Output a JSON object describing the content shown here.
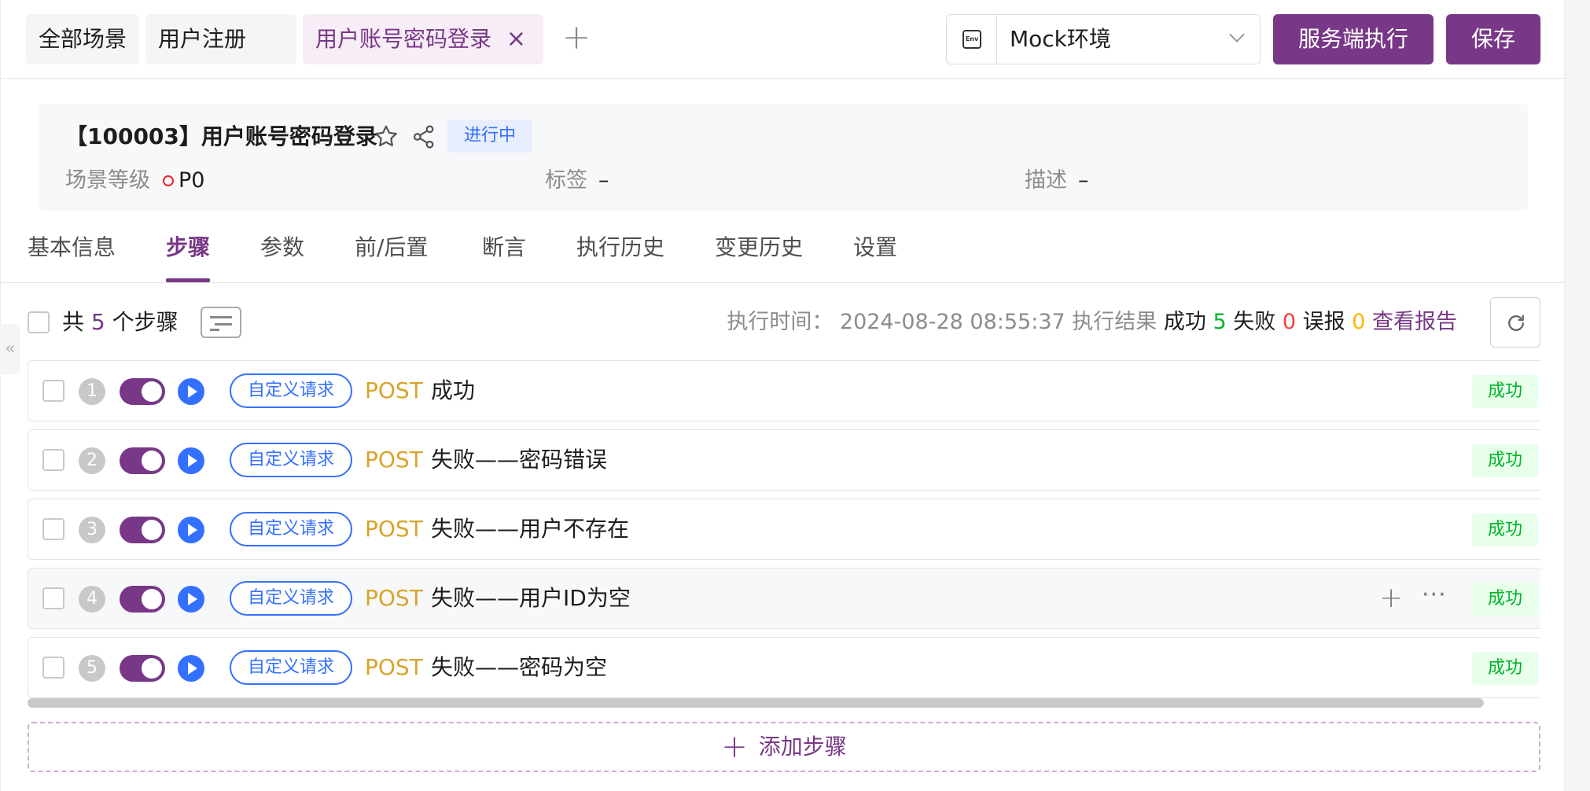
{
  "tabs": [
    {
      "label": "全部场景",
      "active": false
    },
    {
      "label": "用户注册",
      "active": false
    },
    {
      "label": "用户账号密码登录",
      "active": true
    }
  ],
  "tab_add_label": "+",
  "tab_close_label": "×",
  "env": {
    "icon": "env-icon",
    "icon_text": "Env",
    "label": "Mock环境"
  },
  "actions": {
    "server_execute": "服务端执行",
    "save": "保存"
  },
  "case": {
    "title": "【100003】用户账号密码登录",
    "status": "进行中",
    "level_label": "场景等级",
    "level_value": "P0",
    "tags_label": "标签",
    "tags_value": "–",
    "desc_label": "描述",
    "desc_value": "–"
  },
  "nav_tabs": [
    "基本信息",
    "步骤",
    "参数",
    "前/后置",
    "断言",
    "执行历史",
    "变更历史",
    "设置"
  ],
  "active_nav_tab": "步骤",
  "collapse_handle": "«",
  "summary": {
    "prefix": "共",
    "count": "5",
    "suffix": "个步骤"
  },
  "execution": {
    "time_label": "执行时间：",
    "time_value": "2024-08-28 08:55:37",
    "result_label": "执行结果",
    "success_label": "成功",
    "success_count": "5",
    "fail_label": "失败",
    "fail_count": "0",
    "false_positive_label": "误报",
    "false_positive_count": "0",
    "report_link": "查看报告"
  },
  "steps": [
    {
      "num": "1",
      "type": "自定义请求",
      "method": "POST",
      "name": "成功",
      "status": "成功"
    },
    {
      "num": "2",
      "type": "自定义请求",
      "method": "POST",
      "name": "失败——密码错误",
      "status": "成功"
    },
    {
      "num": "3",
      "type": "自定义请求",
      "method": "POST",
      "name": "失败——用户不存在",
      "status": "成功"
    },
    {
      "num": "4",
      "type": "自定义请求",
      "method": "POST",
      "name": "失败——用户ID为空",
      "status": "成功"
    },
    {
      "num": "5",
      "type": "自定义请求",
      "method": "POST",
      "name": "失败——密码为空",
      "status": "成功"
    }
  ],
  "row_actions": {
    "add": "+",
    "more": "···"
  },
  "add_step": {
    "icon": "+",
    "label": "添加步骤"
  },
  "colors": {
    "primary": "#783887",
    "blue": "#3370ff",
    "success": "#00b42a",
    "fail": "#f53f3f",
    "warn": "#ffb400",
    "method": "#d8a42a"
  }
}
